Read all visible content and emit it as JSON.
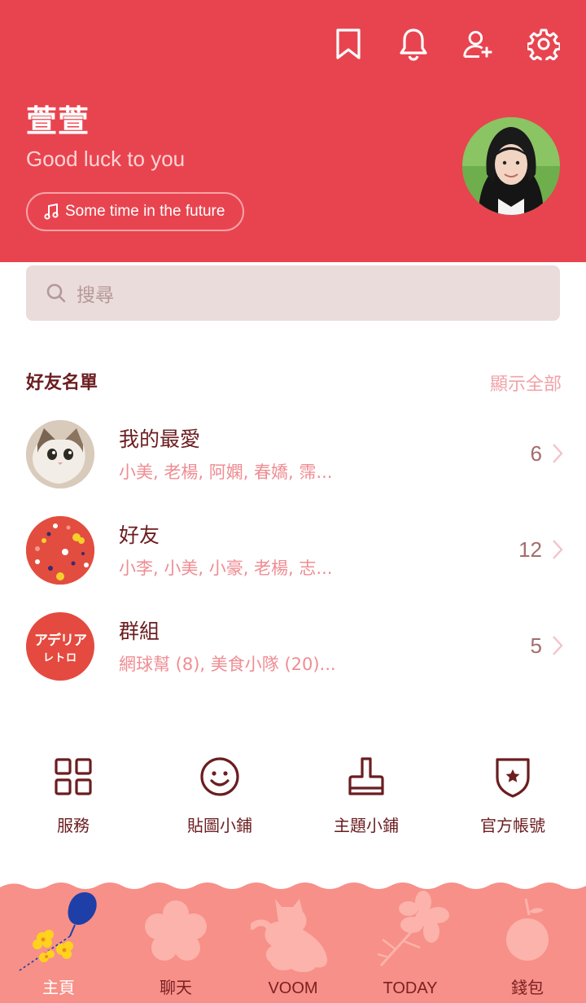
{
  "header": {
    "name": "萱萱",
    "status": "Good luck to you",
    "music": "Some time in the future",
    "icons": [
      "bookmark-icon",
      "bell-icon",
      "add-friend-icon",
      "settings-icon"
    ],
    "color": "#e8444f"
  },
  "search": {
    "placeholder": "搜尋"
  },
  "friends": {
    "title": "好友名單",
    "show_all": "顯示全部",
    "groups": [
      {
        "title": "我的最愛",
        "members": "小美, 老楊, 阿嫻, 春嬌, 霈...",
        "count": "6"
      },
      {
        "title": "好友",
        "members": "小李, 小美, 小豪, 老楊, 志...",
        "count": "12"
      },
      {
        "title": "群組",
        "members": "網球幫 (8), 美食小隊 (20)...",
        "count": "5"
      }
    ],
    "group_logo_text": {
      "line1": "アデリア",
      "line2": "レトロ"
    }
  },
  "services": [
    {
      "label": "服務",
      "icon": "grid-icon"
    },
    {
      "label": "貼圖小鋪",
      "icon": "smiley-icon"
    },
    {
      "label": "主題小鋪",
      "icon": "brush-icon"
    },
    {
      "label": "官方帳號",
      "icon": "shield-star-icon"
    }
  ],
  "bottom_nav": {
    "tabs": [
      {
        "label": "主頁",
        "icon": "balloon-flower-icon",
        "active": true
      },
      {
        "label": "聊天",
        "icon": "flower-icon",
        "active": false
      },
      {
        "label": "VOOM",
        "icon": "cat-icon",
        "active": false
      },
      {
        "label": "TODAY",
        "icon": "blossom-branch-icon",
        "active": false
      },
      {
        "label": "錢包",
        "icon": "fruit-icon",
        "active": false
      }
    ],
    "color": "#f79088"
  }
}
